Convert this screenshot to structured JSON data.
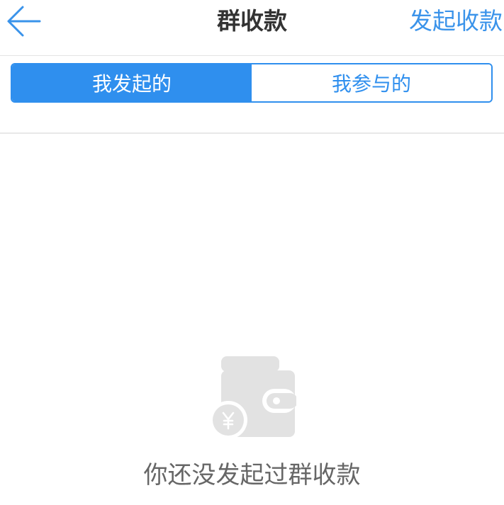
{
  "header": {
    "title": "群收款",
    "action_label": "发起收款",
    "back_icon": "back-arrow-icon"
  },
  "tabs": [
    {
      "label": "我发起的",
      "active": true
    },
    {
      "label": "我参与的",
      "active": false
    }
  ],
  "empty_state": {
    "icon": "wallet-yuan-icon",
    "message": "你还没发起过群收款"
  },
  "colors": {
    "accent": "#2f8fee",
    "title_text": "#333333",
    "empty_text": "#666666",
    "icon_gray": "#e2e2e2"
  }
}
